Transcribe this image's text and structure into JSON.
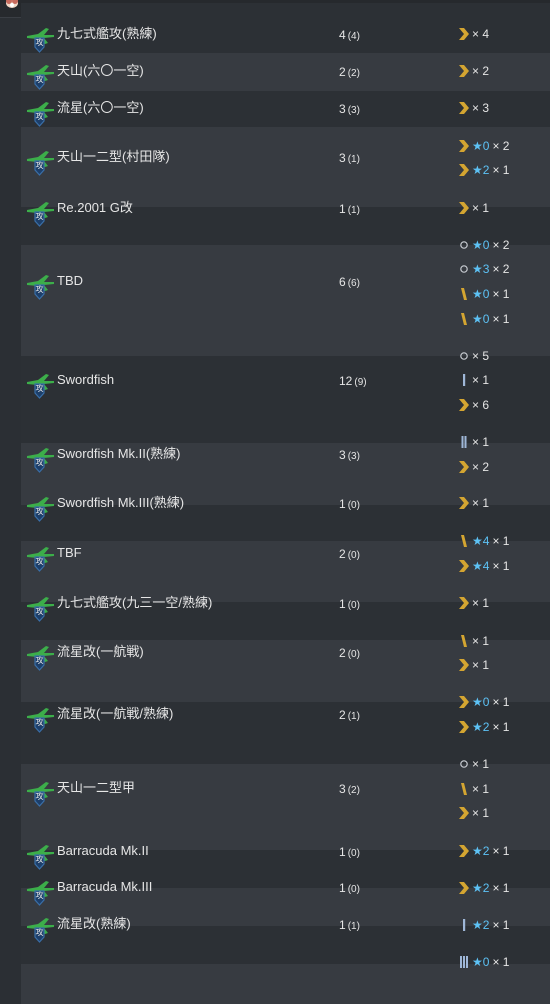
{
  "colors": {
    "row_odd": "#373b41",
    "row_even": "#2c3035",
    "star": "#5dc2f5",
    "chevron": "#d4a531",
    "plane_green": "#3cae4a",
    "shield_blue": "#3a6fa8"
  },
  "icon_label": "攻",
  "rows": [
    {
      "name": "九七式艦攻(熟練)",
      "count": "4",
      "sub": "(4)",
      "details": [
        {
          "icon": "chevron-icon",
          "stars": "",
          "mult": "× 4"
        }
      ]
    },
    {
      "name": "天山(六〇一空)",
      "count": "2",
      "sub": "(2)",
      "details": [
        {
          "icon": "chevron-icon",
          "stars": "",
          "mult": "× 2"
        }
      ]
    },
    {
      "name": "流星(六〇一空)",
      "count": "3",
      "sub": "(3)",
      "details": [
        {
          "icon": "chevron-icon",
          "stars": "",
          "mult": "× 3"
        }
      ]
    },
    {
      "name": "天山一二型(村田隊)",
      "count": "3",
      "sub": "(1)",
      "details": [
        {
          "icon": "chevron-icon",
          "stars": "★0",
          "mult": "× 2"
        },
        {
          "icon": "chevron-icon",
          "stars": "★2",
          "mult": "× 1"
        }
      ]
    },
    {
      "name": "Re.2001 G改",
      "count": "1",
      "sub": "(1)",
      "details": [
        {
          "icon": "chevron-icon",
          "stars": "",
          "mult": "× 1"
        }
      ]
    },
    {
      "name": "TBD",
      "count": "6",
      "sub": "(6)",
      "details": [
        {
          "icon": "circle-icon",
          "stars": "★0",
          "mult": "× 2"
        },
        {
          "icon": "circle-icon",
          "stars": "★3",
          "mult": "× 2"
        },
        {
          "icon": "slash-icon",
          "stars": "★0",
          "mult": "× 1"
        },
        {
          "icon": "slash-icon",
          "stars": "★0",
          "mult": "× 1"
        }
      ]
    },
    {
      "name": "Swordfish",
      "count": "12",
      "sub": "(9)",
      "details": [
        {
          "icon": "circle-icon",
          "stars": "",
          "mult": "× 5"
        },
        {
          "icon": "bar1-icon",
          "stars": "",
          "mult": "× 1"
        },
        {
          "icon": "chevron-icon",
          "stars": "",
          "mult": "× 6"
        }
      ]
    },
    {
      "name": "Swordfish Mk.II(熟練)",
      "count": "3",
      "sub": "(3)",
      "details": [
        {
          "icon": "bar2-icon",
          "stars": "",
          "mult": "× 1"
        },
        {
          "icon": "chevron-icon",
          "stars": "",
          "mult": "× 2"
        }
      ]
    },
    {
      "name": "Swordfish Mk.III(熟練)",
      "count": "1",
      "sub": "(0)",
      "details": [
        {
          "icon": "chevron-icon",
          "stars": "",
          "mult": "× 1"
        }
      ]
    },
    {
      "name": "TBF",
      "count": "2",
      "sub": "(0)",
      "details": [
        {
          "icon": "slash-icon",
          "stars": "★4",
          "mult": "× 1"
        },
        {
          "icon": "chevron-icon",
          "stars": "★4",
          "mult": "× 1"
        }
      ]
    },
    {
      "name": "九七式艦攻(九三一空/熟練)",
      "count": "1",
      "sub": "(0)",
      "details": [
        {
          "icon": "chevron-icon",
          "stars": "",
          "mult": "× 1"
        }
      ]
    },
    {
      "name": "流星改(一航戦)",
      "count": "2",
      "sub": "(0)",
      "details": [
        {
          "icon": "slash-icon",
          "stars": "",
          "mult": "× 1"
        },
        {
          "icon": "chevron-icon",
          "stars": "",
          "mult": "× 1"
        }
      ]
    },
    {
      "name": "流星改(一航戦/熟練)",
      "count": "2",
      "sub": "(1)",
      "details": [
        {
          "icon": "chevron-icon",
          "stars": "★0",
          "mult": "× 1"
        },
        {
          "icon": "chevron-icon",
          "stars": "★2",
          "mult": "× 1"
        }
      ]
    },
    {
      "name": "天山一二型甲",
      "count": "3",
      "sub": "(2)",
      "details": [
        {
          "icon": "circle-icon",
          "stars": "",
          "mult": "× 1"
        },
        {
          "icon": "slash-icon",
          "stars": "",
          "mult": "× 1"
        },
        {
          "icon": "chevron-icon",
          "stars": "",
          "mult": "× 1"
        }
      ]
    },
    {
      "name": "Barracuda Mk.II",
      "count": "1",
      "sub": "(0)",
      "details": [
        {
          "icon": "chevron-icon",
          "stars": "★2",
          "mult": "× 1"
        }
      ]
    },
    {
      "name": "Barracuda Mk.III",
      "count": "1",
      "sub": "(0)",
      "details": [
        {
          "icon": "chevron-icon",
          "stars": "★2",
          "mult": "× 1"
        }
      ]
    },
    {
      "name": "流星改(熟練)",
      "count": "1",
      "sub": "(1)",
      "details": [
        {
          "icon": "bar1-icon",
          "stars": "★2",
          "mult": "× 1"
        }
      ]
    },
    {
      "name": "",
      "count": "",
      "sub": "",
      "details": [
        {
          "icon": "bar3-icon",
          "stars": "★0",
          "mult": "× 1"
        }
      ]
    }
  ]
}
